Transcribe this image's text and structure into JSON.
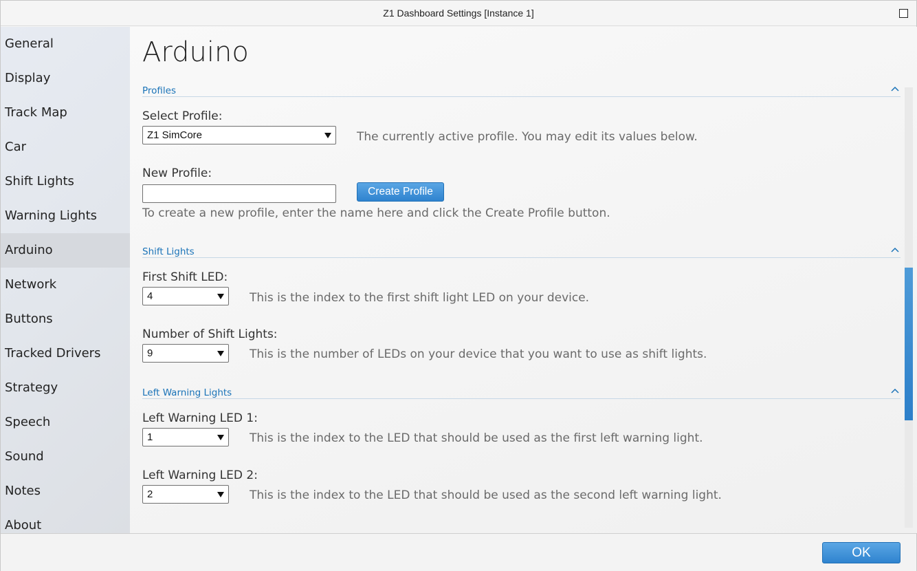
{
  "window": {
    "title": "Z1 Dashboard Settings [Instance 1]"
  },
  "sidebar": {
    "items": [
      {
        "label": "General"
      },
      {
        "label": "Display"
      },
      {
        "label": "Track Map"
      },
      {
        "label": "Car"
      },
      {
        "label": "Shift Lights"
      },
      {
        "label": "Warning Lights"
      },
      {
        "label": "Arduino",
        "active": true
      },
      {
        "label": "Network"
      },
      {
        "label": "Buttons"
      },
      {
        "label": "Tracked Drivers"
      },
      {
        "label": "Strategy"
      },
      {
        "label": "Speech"
      },
      {
        "label": "Sound"
      },
      {
        "label": "Notes"
      },
      {
        "label": "About"
      }
    ]
  },
  "main": {
    "page_title": "Arduino",
    "sections": {
      "profiles": {
        "header": "Profiles",
        "select_label": "Select Profile:",
        "select_value": "Z1 SimCore",
        "select_help": "The currently active profile. You may edit its values below.",
        "new_label": "New Profile:",
        "new_value": "",
        "create_button": "Create Profile",
        "new_help": "To create a new profile, enter the name here and click the Create Profile button."
      },
      "shift_lights": {
        "header": "Shift Lights",
        "first_label": "First Shift LED:",
        "first_value": "4",
        "first_help": "This is the index to the first shift light LED on your device.",
        "count_label": "Number of Shift Lights:",
        "count_value": "9",
        "count_help": "This is the number of LEDs on your device that you want to use as shift lights."
      },
      "left_warning": {
        "header": "Left Warning Lights",
        "led1_label": "Left Warning LED 1:",
        "led1_value": "1",
        "led1_help": "This is the index to the LED that should be used as the first left warning light.",
        "led2_label": "Left Warning LED 2:",
        "led2_value": "2",
        "led2_help": "This is the index to the LED that should be used as the second left warning light."
      }
    }
  },
  "footer": {
    "ok_label": "OK"
  },
  "colors": {
    "accent": "#2f83cf",
    "section_header": "#1a73b8"
  }
}
